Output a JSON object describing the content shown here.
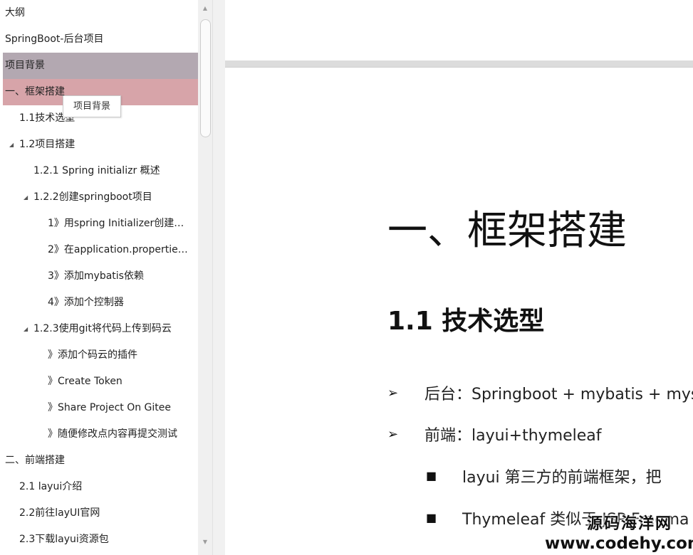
{
  "outline": {
    "items": [
      {
        "label": "大纲",
        "level": 0,
        "arrow": false,
        "state": "normal"
      },
      {
        "label": "SpringBoot-后台项目",
        "level": 0,
        "arrow": false,
        "state": "normal"
      },
      {
        "label": "项目背景",
        "level": 0,
        "arrow": false,
        "state": "selected"
      },
      {
        "label": "一、框架搭建",
        "level": 0,
        "arrow": false,
        "state": "hover"
      },
      {
        "label": "1.1技术选型",
        "level": 1,
        "arrow": false,
        "state": "normal"
      },
      {
        "label": "1.2项目搭建",
        "level": 1,
        "arrow": true,
        "state": "normal"
      },
      {
        "label": "1.2.1 Spring initializr 概述",
        "level": 2,
        "arrow": false,
        "state": "normal"
      },
      {
        "label": "1.2.2创建springboot项目",
        "level": 2,
        "arrow": true,
        "state": "normal"
      },
      {
        "label": "1》用spring Initializer创建…",
        "level": 3,
        "arrow": false,
        "state": "normal"
      },
      {
        "label": "2》在application.propertie…",
        "level": 3,
        "arrow": false,
        "state": "normal"
      },
      {
        "label": "3》添加mybatis依赖",
        "level": 3,
        "arrow": false,
        "state": "normal"
      },
      {
        "label": "4》添加个控制器",
        "level": 3,
        "arrow": false,
        "state": "normal"
      },
      {
        "label": "1.2.3使用git将代码上传到码云",
        "level": 2,
        "arrow": true,
        "state": "normal"
      },
      {
        "label": "》添加个码云的插件",
        "level": 3,
        "arrow": false,
        "state": "normal"
      },
      {
        "label": "》Create Token",
        "level": 3,
        "arrow": false,
        "state": "normal"
      },
      {
        "label": "》Share Project On Gitee",
        "level": 3,
        "arrow": false,
        "state": "normal"
      },
      {
        "label": "》随便修改点内容再提交测试",
        "level": 3,
        "arrow": false,
        "state": "normal"
      },
      {
        "label": "二、前端搭建",
        "level": 0,
        "arrow": false,
        "state": "normal"
      },
      {
        "label": "2.1 layui介绍",
        "level": 1,
        "arrow": false,
        "state": "normal"
      },
      {
        "label": "2.2前往layUI官网",
        "level": 1,
        "arrow": false,
        "state": "normal"
      },
      {
        "label": "2.3下载layui资源包",
        "level": 1,
        "arrow": false,
        "state": "normal"
      }
    ],
    "tooltip": "项目背景"
  },
  "document": {
    "heading1": "一、框架搭建",
    "heading2": "1.1 技术选型",
    "bullets": [
      {
        "marker": "➢",
        "text": "后台：Springboot + mybatis + mys"
      },
      {
        "marker": "➢",
        "text": "前端：layui+thymeleaf"
      },
      {
        "marker": "■",
        "text": "layui 第三方的前端框架，把"
      },
      {
        "marker": "■",
        "text": "Thymeleaf 类似于 JSP,Freema"
      }
    ]
  },
  "watermark": {
    "line1": "源码海洋网",
    "line2": "www.codehy.com"
  },
  "colors": {
    "selected_row": "#b3a8b1",
    "hover_row": "#d7a4a9",
    "page_gap": "#dcdcdc"
  }
}
